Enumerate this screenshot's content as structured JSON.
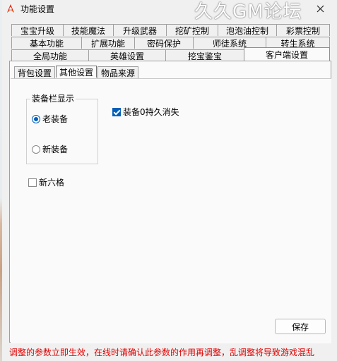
{
  "window": {
    "title": "功能设置",
    "watermark": "久久GM论坛"
  },
  "tabs": {
    "row1": [
      "宝宝升级",
      "技能魔法",
      "升级武器",
      "挖矿控制",
      "泡泡油控制",
      "彩票控制"
    ],
    "row2": [
      "基本功能",
      "扩展功能",
      "密码保护",
      "师徒系统",
      "转生系统"
    ],
    "row3": [
      "全局功能",
      "英雄设置",
      "挖宝鉴宝",
      "客户端设置"
    ]
  },
  "subtabs": [
    "背包设置",
    "其他设置",
    "物品来源"
  ],
  "equip_group": {
    "title": "装备栏显示",
    "options": [
      {
        "label": "老装备",
        "selected": true
      },
      {
        "label": "新装备",
        "selected": false
      }
    ]
  },
  "checks": {
    "durability": {
      "label": "装备0持久消失",
      "checked": true
    },
    "new_six": {
      "label": "新六格",
      "checked": false
    }
  },
  "buttons": {
    "save": "保存"
  },
  "footer": {
    "notice": "调整的参数立即生效，在线时请确认此参数的作用再调整，乱调整将导致游戏混乱"
  },
  "colors": {
    "accent": "#005fb8",
    "notice": "#e00000"
  }
}
